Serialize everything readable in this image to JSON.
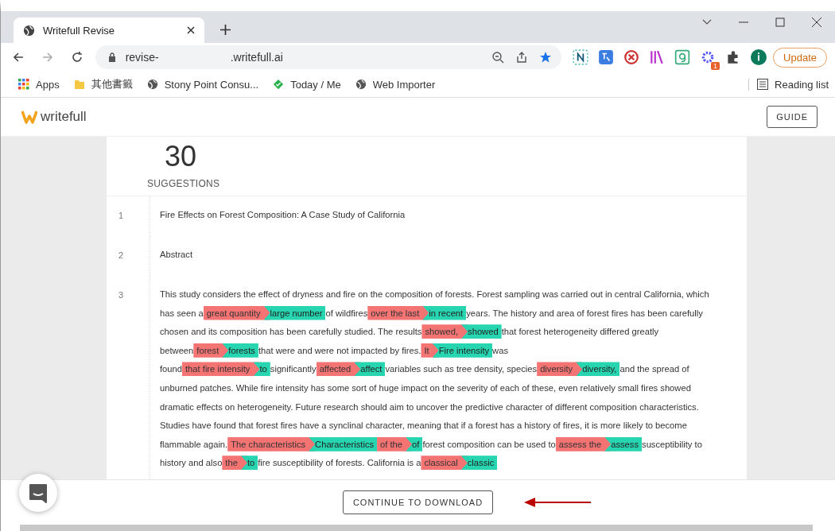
{
  "browser": {
    "tab": {
      "title": "Writefull Revise"
    },
    "address": {
      "prefix": "revise-",
      "suffix": ".writefull.ai"
    },
    "update_button": "Update",
    "extension_badge": "1",
    "bookmarks": [
      {
        "label": "Apps",
        "kind": "apps"
      },
      {
        "label": "其他書籤",
        "kind": "folder"
      },
      {
        "label": "Stony Point Consu...",
        "kind": "globe"
      },
      {
        "label": "Today / Me",
        "kind": "diamond"
      },
      {
        "label": "Web Importer",
        "kind": "globe"
      }
    ],
    "reading_list": "Reading list"
  },
  "app": {
    "logo": "writefull",
    "guide_button": "GUIDE",
    "count": "30",
    "count_label": "SUGGESTIONS",
    "lines": [
      {
        "number": "1",
        "segments": [
          {
            "kind": "text",
            "text": "Fire Effects on Forest Composition: A Case Study of California"
          }
        ]
      },
      {
        "number": "2",
        "segments": [
          {
            "kind": "text",
            "text": "Abstract"
          }
        ]
      },
      {
        "number": "3",
        "segments": [
          {
            "kind": "text",
            "text": "This study considers the effect of dryness and fire on the composition of forests. Forest sampling was carried out in central California, which has seen a"
          },
          {
            "kind": "edit",
            "from": "great quantity",
            "to": "large number"
          },
          {
            "kind": "text",
            "text": "of wildfires"
          },
          {
            "kind": "edit",
            "from": "over the last",
            "to": "in recent"
          },
          {
            "kind": "text",
            "text": "years. The history and area of forest fires has been carefully chosen and its composition has been carefully studied. The results"
          },
          {
            "kind": "edit",
            "from": "showed,",
            "to": "showed"
          },
          {
            "kind": "text",
            "text": "that forest heterogeneity differed greatly between"
          },
          {
            "kind": "edit",
            "from": "forest",
            "to": "forests"
          },
          {
            "kind": "text",
            "text": "that were and were not impacted by fires."
          },
          {
            "kind": "edit",
            "from": "It",
            "to": "Fire intensity"
          },
          {
            "kind": "text",
            "text": "was found"
          },
          {
            "kind": "edit",
            "from": "that fire intensity",
            "to": "to"
          },
          {
            "kind": "text",
            "text": "significantly"
          },
          {
            "kind": "edit",
            "from": "affected",
            "to": "affect"
          },
          {
            "kind": "text",
            "text": "variables such as tree density, species"
          },
          {
            "kind": "edit",
            "from": "diversity",
            "to": "diversity,"
          },
          {
            "kind": "text",
            "text": "and the spread of unburned patches. While fire intensity has some sort of huge impact on the severity of each of these, even relatively small fires showed dramatic effects on heterogeneity. Future research should aim to uncover the predictive character of different composition characteristics. Studies have found that forest fires have a synclinal character, meaning that if a forest has a history of fires, it is more likely to become flammable again."
          },
          {
            "kind": "edit",
            "from": "The characteristics",
            "to": "Characteristics"
          },
          {
            "kind": "edit",
            "from": "of the",
            "to": "of"
          },
          {
            "kind": "text",
            "text": "forest composition can be used to"
          },
          {
            "kind": "edit",
            "from": "assess the",
            "to": "assess"
          },
          {
            "kind": "text",
            "text": "susceptibility to history and also"
          },
          {
            "kind": "edit",
            "from": "the",
            "to": "to"
          },
          {
            "kind": "text",
            "text": "fire susceptibility of forests. California is a"
          },
          {
            "kind": "edit",
            "from": "classical",
            "to": "classic"
          }
        ]
      }
    ],
    "continue_button": "CONTINUE TO DOWNLOAD"
  }
}
